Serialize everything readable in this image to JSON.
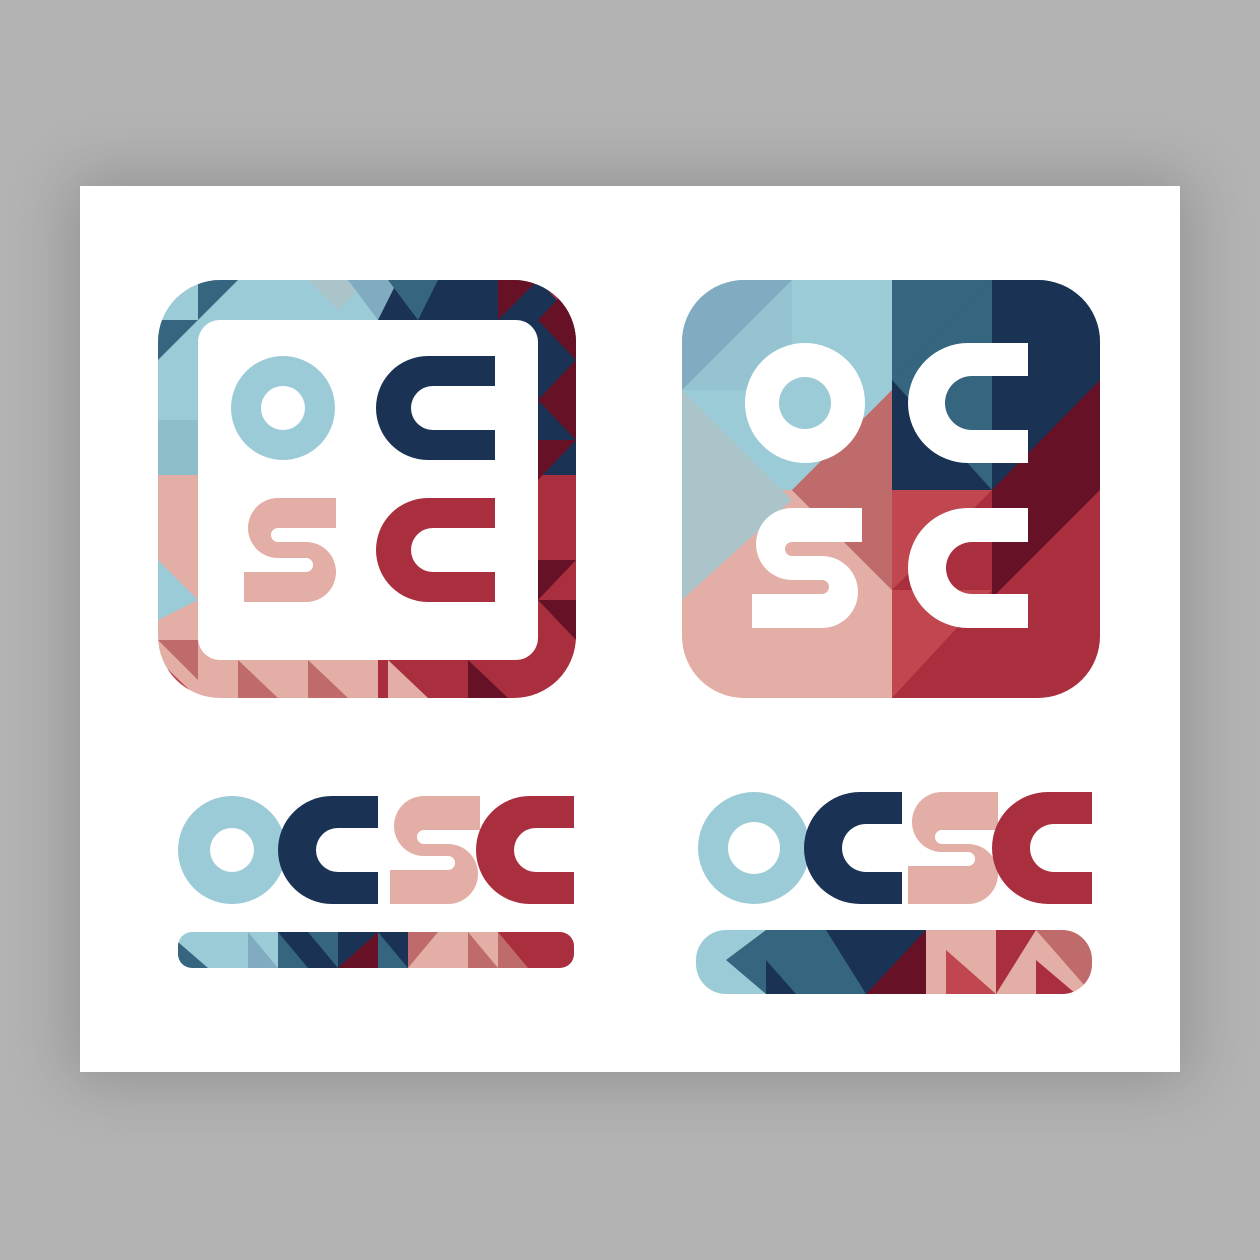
{
  "artboard": {
    "background": "#b3b3b3",
    "card_color": "#ffffff"
  },
  "palette": {
    "light_blue": "#9ccbd8",
    "pale_blue": "#aac4ca",
    "steel_blue": "#80abc0",
    "mid_blue": "#36657f",
    "navy": "#1a3355",
    "maroon": "#661126",
    "crimson": "#aa2f3e",
    "red": "#c04650",
    "rose": "#c06b6b",
    "pink": "#e2aea5",
    "white": "#ffffff"
  },
  "logos": [
    {
      "id": "framed-square",
      "letters": [
        "o",
        "c",
        "s",
        "c"
      ],
      "layout": "2x2",
      "letter_colors": [
        "light_blue",
        "navy",
        "pink",
        "crimson"
      ]
    },
    {
      "id": "solid-square",
      "letters": [
        "o",
        "c",
        "s",
        "c"
      ],
      "layout": "2x2",
      "letter_colors": [
        "white",
        "white",
        "white",
        "white"
      ]
    },
    {
      "id": "wordmark-strip",
      "letters": [
        "o",
        "c",
        "s",
        "c"
      ],
      "layout": "row",
      "letter_colors": [
        "light_blue",
        "navy",
        "pink",
        "crimson"
      ]
    },
    {
      "id": "wordmark-nj",
      "letters": [
        "o",
        "c",
        "s",
        "c"
      ],
      "layout": "row",
      "letter_colors": [
        "light_blue",
        "navy",
        "pink",
        "crimson"
      ],
      "tag": "NJ"
    }
  ]
}
